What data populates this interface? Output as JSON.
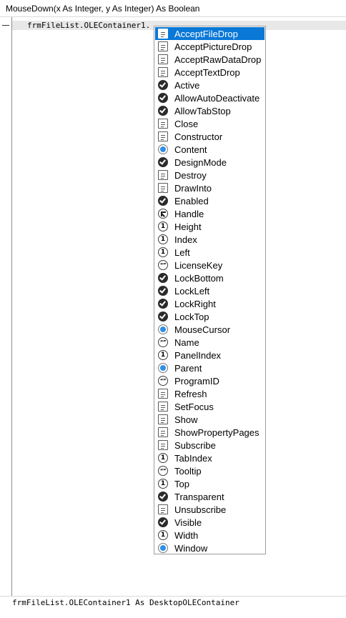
{
  "signature": "MouseDown(x As Integer, y As Integer) As Boolean",
  "editor": {
    "code_text": "frmFileList.OLEContainer1."
  },
  "autocomplete": {
    "selected_index": 0,
    "items": [
      {
        "label": "AcceptFileDrop",
        "icon": "method-icon"
      },
      {
        "label": "AcceptPictureDrop",
        "icon": "method-icon"
      },
      {
        "label": "AcceptRawDataDrop",
        "icon": "method-icon"
      },
      {
        "label": "AcceptTextDrop",
        "icon": "method-icon"
      },
      {
        "label": "Active",
        "icon": "boolean-icon"
      },
      {
        "label": "AllowAutoDeactivate",
        "icon": "boolean-icon"
      },
      {
        "label": "AllowTabStop",
        "icon": "boolean-icon"
      },
      {
        "label": "Close",
        "icon": "method-icon"
      },
      {
        "label": "Constructor",
        "icon": "method-icon"
      },
      {
        "label": "Content",
        "icon": "object-icon"
      },
      {
        "label": "DesignMode",
        "icon": "boolean-icon"
      },
      {
        "label": "Destroy",
        "icon": "method-icon"
      },
      {
        "label": "DrawInto",
        "icon": "method-icon"
      },
      {
        "label": "Enabled",
        "icon": "boolean-icon"
      },
      {
        "label": "Handle",
        "icon": "handle-icon"
      },
      {
        "label": "Height",
        "icon": "number-icon"
      },
      {
        "label": "Index",
        "icon": "number-icon"
      },
      {
        "label": "Left",
        "icon": "number-icon"
      },
      {
        "label": "LicenseKey",
        "icon": "string-icon"
      },
      {
        "label": "LockBottom",
        "icon": "boolean-icon"
      },
      {
        "label": "LockLeft",
        "icon": "boolean-icon"
      },
      {
        "label": "LockRight",
        "icon": "boolean-icon"
      },
      {
        "label": "LockTop",
        "icon": "boolean-icon"
      },
      {
        "label": "MouseCursor",
        "icon": "object-icon"
      },
      {
        "label": "Name",
        "icon": "string-icon"
      },
      {
        "label": "PanelIndex",
        "icon": "number-icon"
      },
      {
        "label": "Parent",
        "icon": "object-icon"
      },
      {
        "label": "ProgramID",
        "icon": "string-icon"
      },
      {
        "label": "Refresh",
        "icon": "method-icon"
      },
      {
        "label": "SetFocus",
        "icon": "method-icon"
      },
      {
        "label": "Show",
        "icon": "method-icon"
      },
      {
        "label": "ShowPropertyPages",
        "icon": "method-icon"
      },
      {
        "label": "Subscribe",
        "icon": "method-icon"
      },
      {
        "label": "TabIndex",
        "icon": "number-icon"
      },
      {
        "label": "Tooltip",
        "icon": "string-icon"
      },
      {
        "label": "Top",
        "icon": "number-icon"
      },
      {
        "label": "Transparent",
        "icon": "boolean-icon"
      },
      {
        "label": "Unsubscribe",
        "icon": "method-icon"
      },
      {
        "label": "Visible",
        "icon": "boolean-icon"
      },
      {
        "label": "Width",
        "icon": "number-icon"
      },
      {
        "label": "Window",
        "icon": "object-icon"
      }
    ]
  },
  "status": {
    "text": "frmFileList.OLEContainer1 As DesktopOLEContainer"
  },
  "colors": {
    "selection": "#0a78d7",
    "object_icon": "#2f8fe6"
  }
}
